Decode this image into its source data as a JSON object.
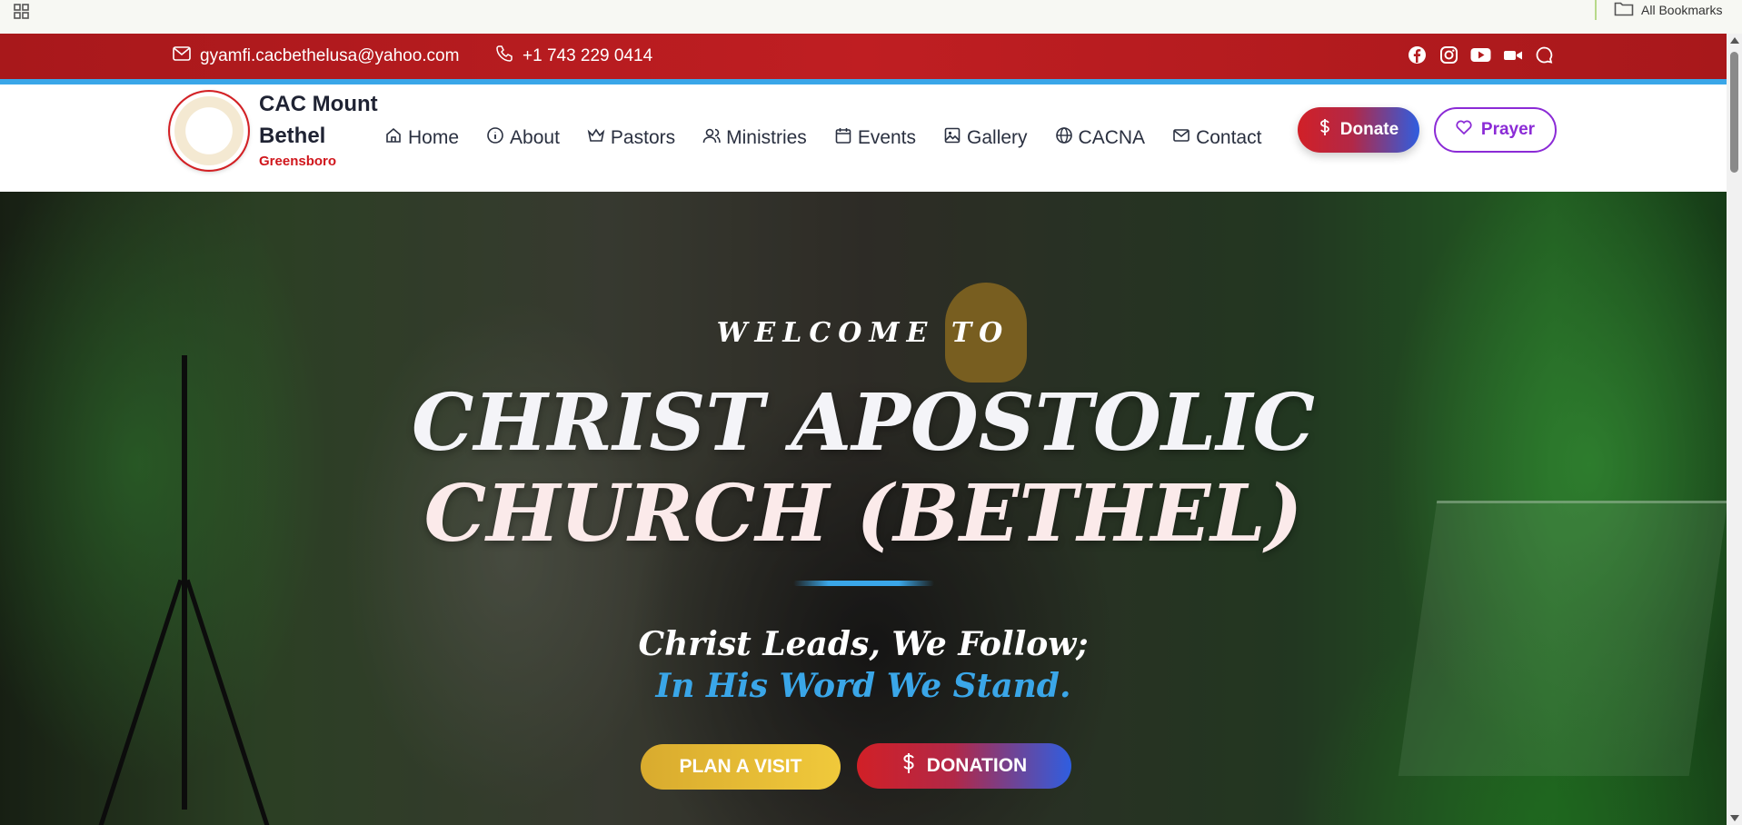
{
  "browser": {
    "bookmarks_label": "All Bookmarks"
  },
  "topbar": {
    "email": "gyamfi.cacbethelusa@yahoo.com",
    "phone": "+1 743 229 0414",
    "socials": [
      "facebook-icon",
      "instagram-icon",
      "youtube-icon",
      "video-icon",
      "chat-icon"
    ]
  },
  "header": {
    "brand_name": "CAC Mount Bethel",
    "brand_city": "Greensboro",
    "nav": [
      {
        "label": "Home",
        "icon": "home-icon"
      },
      {
        "label": "About",
        "icon": "info-icon"
      },
      {
        "label": "Pastors",
        "icon": "crown-icon"
      },
      {
        "label": "Ministries",
        "icon": "users-icon"
      },
      {
        "label": "Events",
        "icon": "calendar-icon"
      },
      {
        "label": "Gallery",
        "icon": "image-icon"
      },
      {
        "label": "CACNA",
        "icon": "globe-icon"
      },
      {
        "label": "Contact",
        "icon": "mail-icon"
      }
    ],
    "donate_label": "Donate",
    "prayer_label": "Prayer"
  },
  "hero": {
    "welcome": "WELCOME TO",
    "title_line1": "CHRIST APOSTOLIC",
    "title_line2": "CHURCH (BETHEL)",
    "tagline_line1": "Christ Leads, We Follow;",
    "tagline_line2": "In His Word We Stand.",
    "plan_visit_label": "PLAN A VISIT",
    "donation_label": "DONATION"
  },
  "colors": {
    "topbar_red": "#b31b1e",
    "accent_blue": "#3aa6e8",
    "brand_red": "#d0161c",
    "prayer_purple": "#8b2bd6",
    "plan_gold": "#e5bb35"
  }
}
